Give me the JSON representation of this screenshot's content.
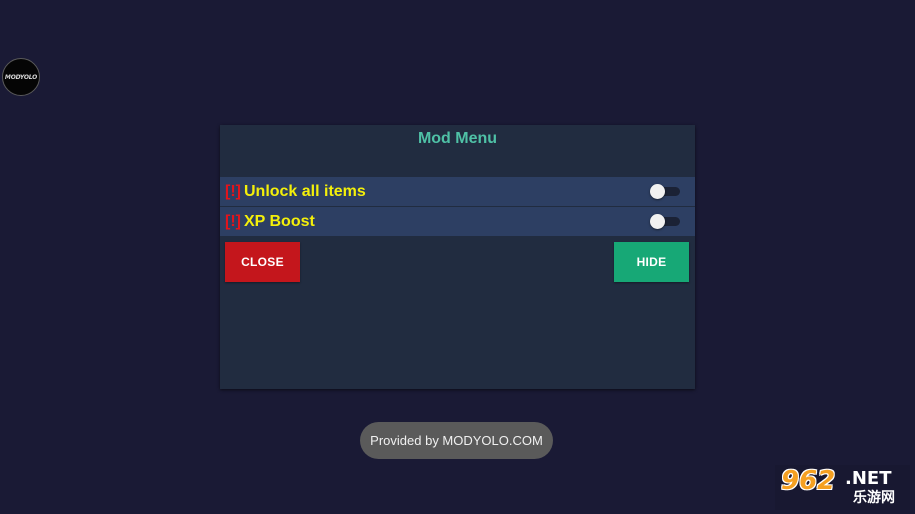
{
  "floating_logo": {
    "text": "MODYOLO"
  },
  "panel": {
    "title": "Mod Menu",
    "mods": [
      {
        "marker": "[!]",
        "label": "Unlock all items",
        "enabled": false
      },
      {
        "marker": "[!]",
        "label": "XP Boost",
        "enabled": false
      }
    ],
    "close_label": "CLOSE",
    "hide_label": "HIDE"
  },
  "toast": {
    "text": "Provided by MODYOLO.COM"
  },
  "watermark": {
    "number": "962",
    "domain": ".NET",
    "chinese": "乐游网"
  },
  "colors": {
    "background": "#1a1a35",
    "panel": "#212c40",
    "row": "#2d3f63",
    "title": "#4fc1a6",
    "label": "#f4f00a",
    "marker": "#e3141b",
    "close": "#c4161c",
    "hide": "#17a876"
  }
}
